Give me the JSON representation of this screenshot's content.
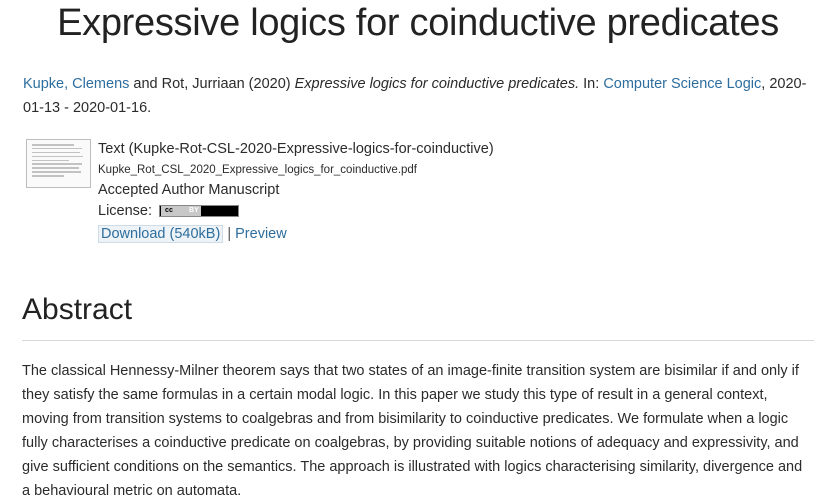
{
  "page": {
    "title": "Expressive logics for coinductive predicates"
  },
  "citation": {
    "author1": "Kupke, Clemens",
    "and_text": " and Rot, Jurriaan (2020) ",
    "paper_title": "Expressive logics for coinductive predicates.",
    "in_text": " In: ",
    "venue": "Computer Science Logic",
    "dates": ", 2020-01-13 - 2020-01-16."
  },
  "file": {
    "type_text": "Text (Kupke-Rot-CSL-2020-Expressive-logics-for-coinductive)",
    "filename": "Kupke_Rot_CSL_2020_Expressive_logics_for_coinductive.pdf",
    "version": "Accepted Author Manuscript",
    "license_label": "License: ",
    "license_badge_cc": "cc",
    "license_badge_by": "BY",
    "download_label": "Download (540kB)",
    "separator": " | ",
    "preview_label": "Preview"
  },
  "abstract": {
    "heading": "Abstract",
    "text": "The classical Hennessy-Milner theorem says that two states of an image-finite transition system are bisimilar if and only if they satisfy the same formulas in a certain modal logic. In this paper we study this type of result in a general context, moving from transition systems to coalgebras and from bisimilarity to coinductive predicates. We formulate when a logic fully characterises a coinductive predicate on coalgebras, by providing suitable notions of adequacy and expressivity, and give sufficient conditions on the semantics. The approach is illustrated with logics characterising similarity, divergence and a behavioural metric on automata."
  }
}
